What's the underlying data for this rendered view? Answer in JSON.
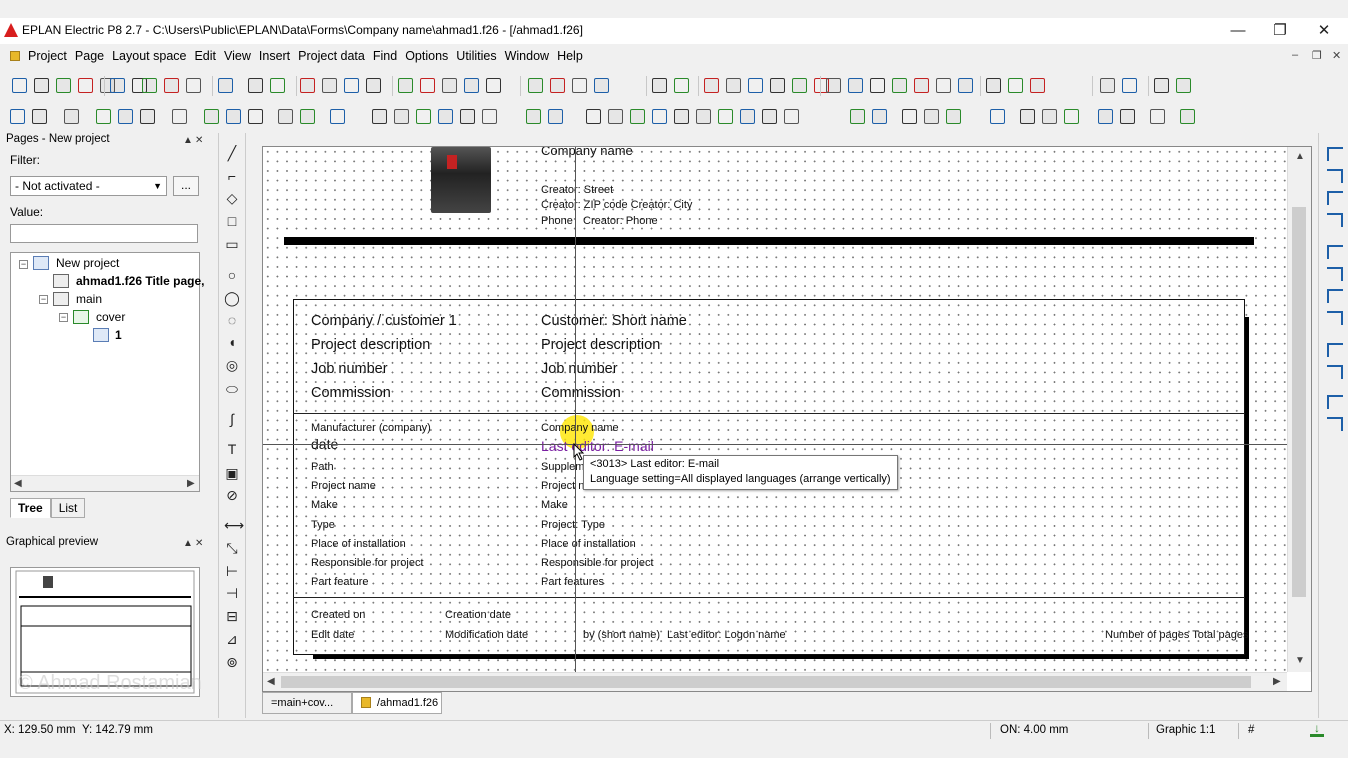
{
  "window": {
    "title": "EPLAN Electric P8 2.7 - C:\\Users\\Public\\EPLAN\\Data\\Forms\\Company name\\ahmad1.f26 - [/ahmad1.f26]",
    "minimize": "—",
    "restore": "❐",
    "close": "✕"
  },
  "menu": {
    "items": [
      "Project",
      "Page",
      "Layout space",
      "Edit",
      "View",
      "Insert",
      "Project data",
      "Find",
      "Options",
      "Utilities",
      "Window",
      "Help"
    ],
    "mdi_min": "–",
    "mdi_restore": "❐",
    "mdi_close": "✕"
  },
  "pages_panel": {
    "title": "Pages - New project",
    "pin": "▲",
    "close": "✕",
    "filter_label": "Filter:",
    "filter_value": "- Not activated -",
    "filter_more": "...",
    "value_label": "Value:",
    "value": "",
    "tree": {
      "root": "New project",
      "form": "ahmad1.f26 Title page,",
      "main": "main",
      "cover": "cover",
      "page": "1"
    },
    "tabs": [
      "Tree",
      "List"
    ]
  },
  "preview_panel": {
    "title": "Graphical preview",
    "pin": "▲",
    "close": "✕"
  },
  "watermark": "© Ahmad Rostamian",
  "form": {
    "header": {
      "company_name": "Company name",
      "street": "Creator: Street",
      "zip_city": "Creator: ZIP code  Creator: City",
      "phone_label": "Phone",
      "phone_value": "Creator: Phone"
    },
    "block1_left": [
      "Company / customer 1",
      "Project description",
      "Job number",
      "Commission"
    ],
    "block1_right": [
      "Customer: Short name",
      "Project description",
      "Job number",
      "Commission"
    ],
    "block2_left": [
      "Manufacturer (company)",
      "date",
      "Path",
      "Project name",
      "Make",
      "Type",
      "Place of installation",
      "Responsible for project",
      "Part feature"
    ],
    "block2_right": [
      "Company name",
      "Last editor: E-mail",
      "Supplement",
      "Project name",
      "Make",
      "Project: Type",
      "Place of installation",
      "Responsible for project",
      "Part features"
    ],
    "footer": {
      "created_on": "Created on",
      "creation_date": "Creation date",
      "edit_date": "Edit date",
      "modification_date": "Modification date",
      "by": "by (short name)",
      "last_editor": "Last editor: Logon name",
      "pages": "Number of pages  Total pages"
    },
    "tooltip_line1": "<3013> Last editor: E-mail",
    "tooltip_line2": "Language setting=All displayed languages (arrange vertically)"
  },
  "page_tabs": [
    "=main+cov...",
    "/ahmad1.f26"
  ],
  "status": {
    "x": "X: 129.50 mm",
    "y": "Y: 142.79 mm",
    "grid": "ON: 4.00 mm",
    "graphic": "Graphic 1:1",
    "hash": "#"
  },
  "colors": {
    "accent": "#1d5fa8",
    "highlight": "#ffe600",
    "purple_text": "#7a1fa2"
  }
}
